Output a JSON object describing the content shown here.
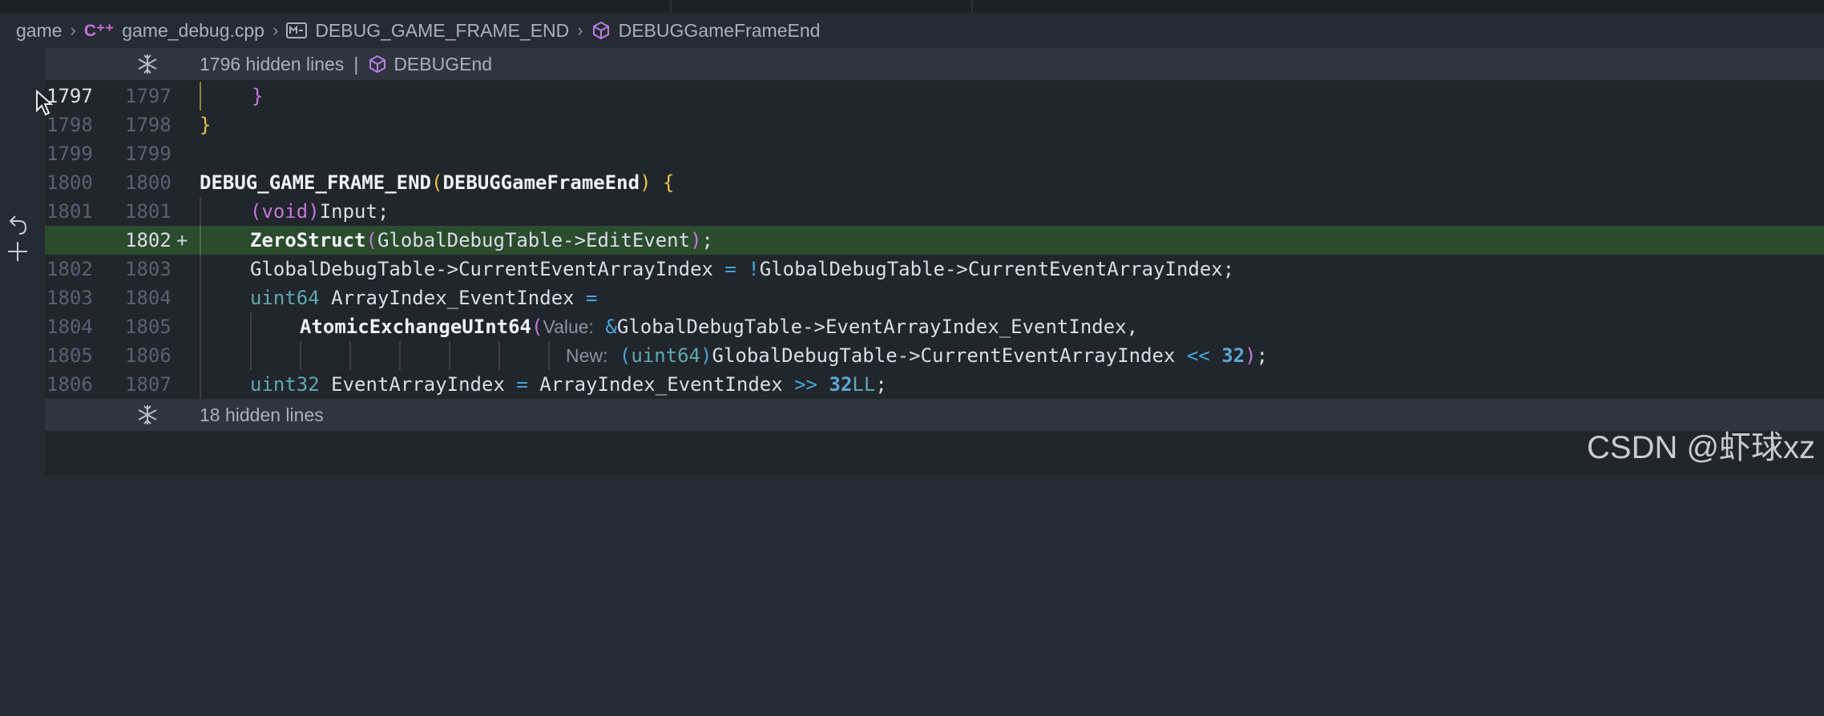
{
  "breadcrumb": {
    "folder": "game",
    "file_icon": "cpp-file-icon",
    "file": "game_debug.cpp",
    "macro": "DEBUG_GAME_FRAME_END",
    "symbol": "DEBUGGameFrameEnd"
  },
  "fold_top": {
    "text": "1796 hidden lines",
    "symbol": "DEBUGEnd"
  },
  "fold_bottom": {
    "text": "18 hidden lines"
  },
  "lines": [
    {
      "old": "1797",
      "new": "1797"
    },
    {
      "old": "1798",
      "new": "1798"
    },
    {
      "old": "1799",
      "new": "1799"
    },
    {
      "old": "1800",
      "new": "1800"
    },
    {
      "old": "1801",
      "new": "1801"
    },
    {
      "old": "",
      "new": "1802",
      "marker": "+"
    },
    {
      "old": "1802",
      "new": "1803"
    },
    {
      "old": "1803",
      "new": "1804"
    },
    {
      "old": "1804",
      "new": "1805"
    },
    {
      "old": "1805",
      "new": "1806"
    },
    {
      "old": "1806",
      "new": "1807"
    }
  ],
  "code": {
    "l1": "}",
    "l2": "}",
    "l4_name": "DEBUG_GAME_FRAME_END",
    "l4_open": "(",
    "l4_arg": "DEBUGGameFrameEnd",
    "l4_close": ")",
    "l4_brace": "{",
    "l5_cast_open": "(",
    "l5_void": "void",
    "l5_cast_close": ")",
    "l5_rest": "Input;",
    "l6_fn": "ZeroStruct",
    "l6_open": "(",
    "l6_arg": "GlobalDebugTable->EditEvent",
    "l6_close": ")",
    "l6_semi": ";",
    "l7_lhs": "GlobalDebugTable->CurrentEventArrayIndex ",
    "l7_eq": "=",
    "l7_not": "!",
    "l7_rhs": "GlobalDebugTable->CurrentEventArrayIndex;",
    "l8_type": "uint64",
    "l8_name": " ArrayIndex_EventIndex ",
    "l8_eq": "=",
    "l9_fn": "AtomicExchangeUInt64",
    "l9_open": "(",
    "l9_hint": "Value:",
    "l9_amp": "&",
    "l9_arg": "GlobalDebugTable->EventArrayIndex_EventIndex,",
    "l10_hint": "New:",
    "l10_cast_open": "(",
    "l10_type": "uint64",
    "l10_cast_close": ")",
    "l10_arg": "GlobalDebugTable->CurrentEventArrayIndex ",
    "l10_shift": "<<",
    "l10_num": "32",
    "l10_close": ")",
    "l10_semi": ";",
    "l11_type": "uint32",
    "l11_name": " EventArrayIndex ",
    "l11_eq": "=",
    "l11_mid": " ArrayIndex_EventIndex ",
    "l11_shift": ">>",
    "l11_num": "32",
    "l11_suffix": "LL",
    "l11_semi": ";"
  },
  "watermark": "CSDN @虾球xz",
  "colors": {
    "editor_bg": "#21252c",
    "added_line_bg": "#2b4b2d",
    "keyword": "#c477d8",
    "type": "#5ea9ad",
    "operator": "#49a5d8",
    "bracket": "#e9c54c"
  }
}
